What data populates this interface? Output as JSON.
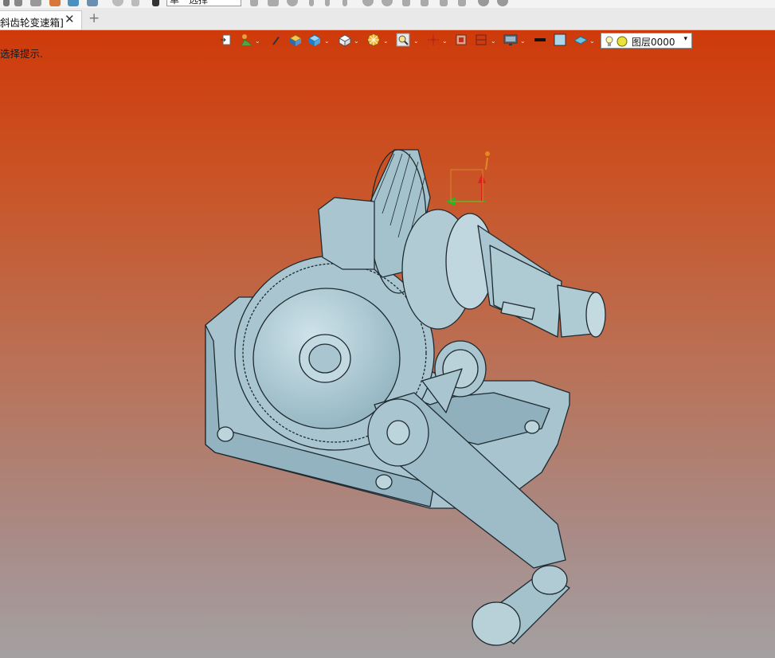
{
  "app": {
    "top_toolbar": {
      "select_filter_value": "单一选择"
    },
    "tab": {
      "label": "斜齿轮变速箱]",
      "close_glyph": "✕",
      "new_tab_glyph": "+"
    },
    "viewport": {
      "hint": "选择提示.",
      "background_top": "#cf3a0a",
      "background_bottom": "#a4a0a2",
      "model_color": "#a9c6d0"
    },
    "view_toolbar": {
      "caret_glyph": "⌄",
      "icons": [
        "fit-view-icon",
        "walk-icon",
        "pin-icon",
        "shaded-box-icon",
        "view-cube-icon",
        "iso-cube-icon",
        "render-mode-icon",
        "zoom-icon",
        "snap-icon",
        "section-icon",
        "clip-icon",
        "display-icon",
        "line-color-icon",
        "fill-color-icon",
        "plane-icon"
      ],
      "layer": {
        "label": "图层0000",
        "dropdown_glyph": "▾"
      }
    }
  }
}
